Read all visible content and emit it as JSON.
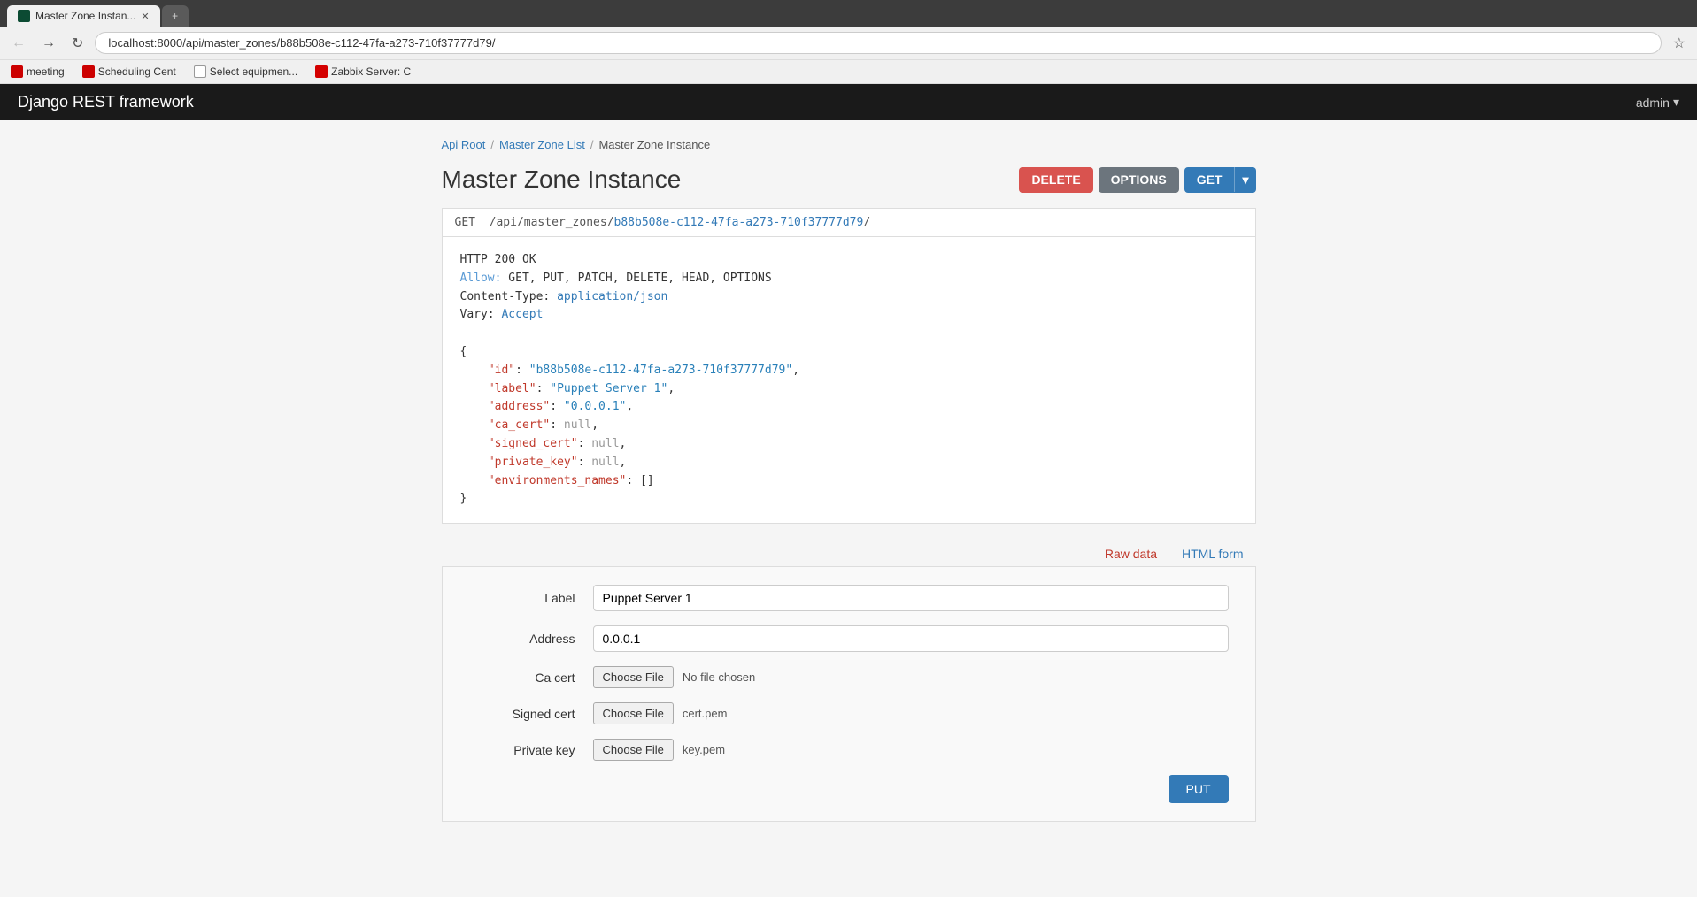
{
  "browser": {
    "tabs": [
      {
        "id": "tab-django",
        "label": "Master Zone Instan...",
        "icon": "django",
        "active": true,
        "closable": true
      },
      {
        "id": "tab-new",
        "label": "",
        "icon": "new",
        "active": false,
        "closable": false
      }
    ],
    "address": "localhost:8000/api/master_zones/b88b508e-c112-47fa-a273-710f37777d79/",
    "bookmarks": [
      {
        "id": "bm-meeting",
        "label": "meeting",
        "icon_color": "bm-red"
      },
      {
        "id": "bm-scheduling",
        "label": "Scheduling Cent",
        "icon_color": "bm-red"
      },
      {
        "id": "bm-select",
        "label": "Select equipmen...",
        "icon_color": "bm-doc"
      },
      {
        "id": "bm-zabbix",
        "label": "Zabbix Server: C",
        "icon_color": "bm-zabbix"
      }
    ]
  },
  "app": {
    "title": "Django REST framework",
    "admin_label": "admin",
    "admin_caret": "▾"
  },
  "breadcrumb": {
    "api_root": "Api Root",
    "master_zone_list": "Master Zone List",
    "current": "Master Zone Instance"
  },
  "page": {
    "title": "Master Zone Instance",
    "buttons": {
      "delete": "DELETE",
      "options": "OPTIONS",
      "get": "GET",
      "get_caret": "▾"
    }
  },
  "get_request": {
    "method": "GET",
    "path_prefix": "/api/master_zones/",
    "path_id_part1": "b88b508e-c112-",
    "path_highlight1": "47fa",
    "path_dash1": "-a273-",
    "path_highlight2": "710f37777d79",
    "path_suffix": "/"
  },
  "response": {
    "status_line": "HTTP 200 OK",
    "allow_label": "Allow:",
    "allow_value": "GET, PUT, PATCH, DELETE, HEAD, OPTIONS",
    "content_type_label": "Content-Type:",
    "content_type_value": "application/json",
    "vary_label": "Vary:",
    "vary_value": "Accept"
  },
  "json_data": {
    "id_key": "\"id\"",
    "id_value": "\"b88b508e-c112-47fa-a273-710f37777d79\"",
    "label_key": "\"label\"",
    "label_value": "\"Puppet Server 1\"",
    "address_key": "\"address\"",
    "address_value": "\"0.0.0.1\"",
    "ca_cert_key": "\"ca_cert\"",
    "ca_cert_value": "null",
    "signed_cert_key": "\"signed_cert\"",
    "signed_cert_value": "null",
    "private_key_key": "\"private_key\"",
    "private_key_value": "null",
    "environments_key": "\"environments_names\"",
    "environments_value": "[]"
  },
  "form": {
    "raw_data_tab": "Raw data",
    "html_form_tab": "HTML form",
    "label_field_label": "Label",
    "label_field_value": "Puppet Server 1",
    "address_field_label": "Address",
    "address_field_value": "0.0.0.1",
    "ca_cert_field_label": "Ca cert",
    "ca_cert_choose": "Choose File",
    "ca_cert_status": "No file chosen",
    "signed_cert_field_label": "Signed cert",
    "signed_cert_choose": "Choose File",
    "signed_cert_file": "cert.pem",
    "private_key_field_label": "Private key",
    "private_key_choose": "Choose File",
    "private_key_file": "key.pem",
    "put_button": "PUT"
  }
}
